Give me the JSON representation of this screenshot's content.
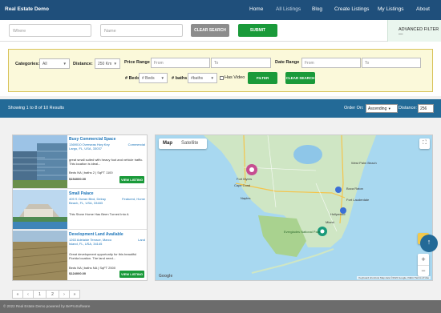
{
  "nav": {
    "brand": "Real Estate Demo",
    "links": [
      "Home",
      "All Listings",
      "Blog",
      "Create Listings",
      "My Listings",
      "About"
    ]
  },
  "search": {
    "where_placeholder": "Where",
    "name_placeholder": "Name",
    "clear_label": "CLEAR SEARCH",
    "submit_label": "SUBMIT",
    "advanced_label": "ADVANCED FILTER —"
  },
  "filter": {
    "categories_label": "Categories:",
    "categories_value": "All",
    "distance_label": "Distance:",
    "distance_value": "250 Km",
    "price_range_label": "Price Range",
    "price_from_placeholder": "From",
    "price_to_placeholder": "To",
    "date_range_label": "Date Range",
    "date_from_placeholder": "From",
    "date_to_placeholder": "To",
    "beds_label": "# Beds",
    "beds_value": "# Beds",
    "baths_label": "# baths",
    "baths_value": "#baths",
    "has_video_label": "Has Video",
    "filter_button": "FILTER",
    "clear_button": "CLEAR SEARCH"
  },
  "results": {
    "summary": "Showing 1 to 8 of 10 Results",
    "order_label": "Order On:",
    "order_value": "Ascending",
    "distance_label": "Distance:",
    "distance_value": "256"
  },
  "listings": [
    {
      "title": "Busy Commercial Space",
      "address": "1369010 Overseas Hwy Key Largo, FL, USA, 33037",
      "type": "Commercial",
      "description": "great small suited with heavy foot and vehicle traffic. This location is ideal...",
      "specs": "Beds NA | baths 2 | SqFT 1100",
      "price": "$154000.00",
      "button": "VIEW LISTING"
    },
    {
      "title": "Small Palace",
      "address": "405 S Ocean Blvd, Delray Beach, FL, USA, 33483",
      "type": "Featured, Home",
      "description": "This Stone Home Has Been Turned Into A",
      "specs": "",
      "price": "",
      "button": "VIEW LISTING"
    },
    {
      "title": "Development Land Available",
      "address": "1263 Adelaide Terrace, Marco Island, FL, USA, 34145",
      "type": "Land",
      "description": "Great development opportunity for this beautiful Florida location. The land need...",
      "specs": "Beds NA | baths NA | SqFT 2500",
      "price": "$124000.00",
      "button": "VIEW LISTING"
    }
  ],
  "map": {
    "tab_map": "Map",
    "tab_satellite": "Satellite",
    "labels": {
      "fort_myers": "Fort Myers",
      "cape_coral": "Cape Coral",
      "west_palm_beach": "West Palm Beach",
      "boca_raton": "Boca Raton",
      "fort_lauderdale": "Fort Lauderdale",
      "hollywood": "Hollywood",
      "miami": "Miami",
      "everglades": "Everglades National Park",
      "naples": "Naples"
    },
    "attribution": "Keyboard shortcuts  Map data ©2022 Google, INEGI  Terms of Use",
    "logo": "Google",
    "zoom_in": "+",
    "zoom_out": "−"
  },
  "pager": {
    "prev": "‹",
    "first": "«",
    "page1": "1",
    "page2": "2",
    "next": "›",
    "last": "»"
  },
  "footer": "© 2022 Real Estate Demo powered by BeProSoftware",
  "colors": {
    "nav_bg": "#1f4f7b",
    "results_bg": "#236a97",
    "accent_green": "#1a9a3a",
    "link_blue": "#1b74b9"
  }
}
